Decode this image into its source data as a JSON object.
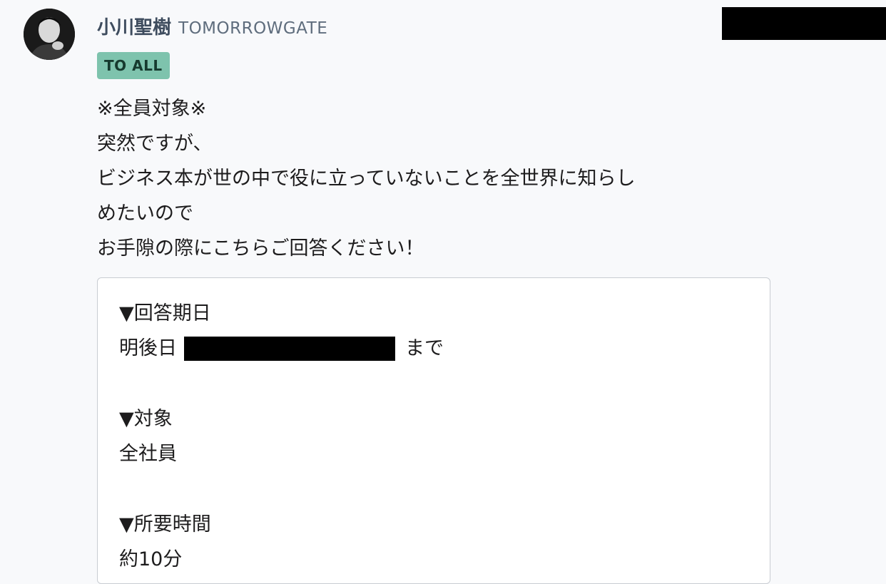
{
  "message": {
    "sender_name": "小川聖樹",
    "sender_org": "TOMORROWGATE",
    "badge": "TO ALL",
    "body_lines": [
      "※全員対象※",
      "突然ですが、",
      "ビジネス本が世の中で役に立っていないことを全世界に知らし",
      "めたいので",
      "お手隙の際にこちらご回答ください！"
    ],
    "card": {
      "deadline_heading": "▼回答期日",
      "deadline_prefix": "明後日",
      "deadline_suffix": "まで",
      "target_heading": "▼対象",
      "target_value": "全社員",
      "duration_heading": "▼所要時間",
      "duration_value": "約10分"
    }
  },
  "colors": {
    "background": "#f8f9fb",
    "badge_bg": "#7ec3ad",
    "badge_text": "#163a2e",
    "sender_name": "#3e4c5e",
    "redaction": "#000000"
  }
}
